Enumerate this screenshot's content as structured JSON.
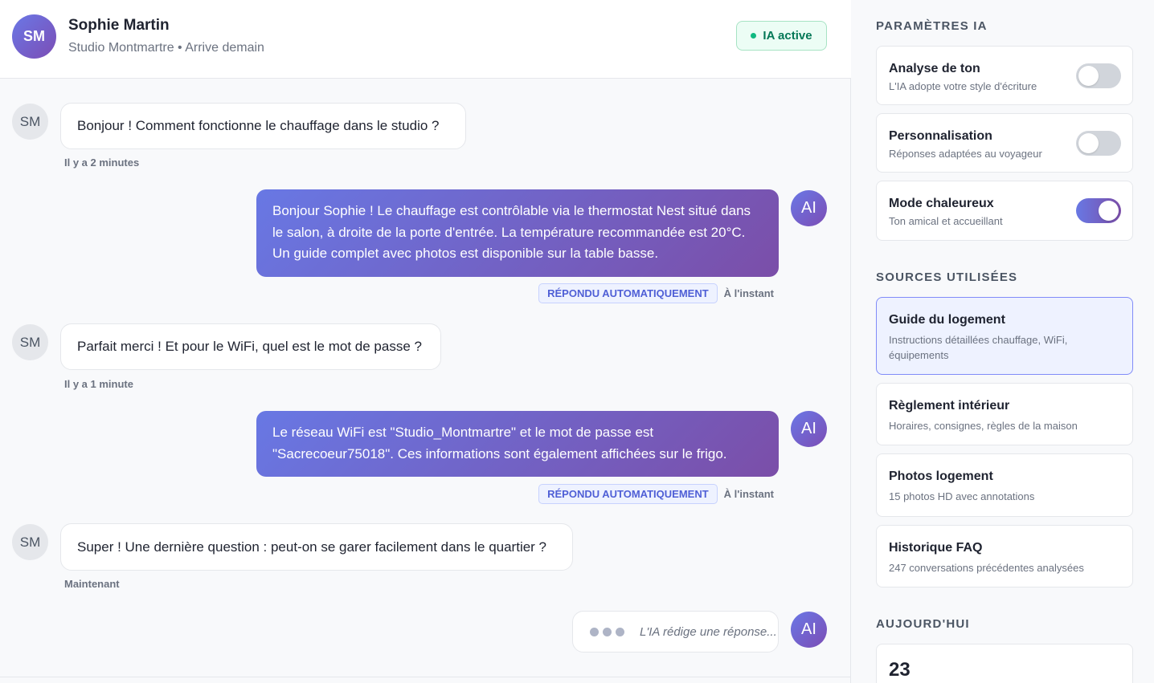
{
  "header": {
    "avatar_initials": "SM",
    "guest_name": "Sophie Martin",
    "subtitle": "Studio Montmartre • Arrive demain",
    "ia_status": "IA active"
  },
  "messages": [
    {
      "from": "guest",
      "avatar": "SM",
      "text": "Bonjour ! Comment fonctionne le chauffage dans le studio ?",
      "time": "Il y a 2 minutes"
    },
    {
      "from": "ai",
      "avatar": "AI",
      "text": "Bonjour Sophie ! Le chauffage est contrôlable via le thermostat Nest situé dans le salon, à droite de la porte d'entrée. La température recommandée est 20°C. Un guide complet avec photos est disponible sur la table basse.",
      "badge": "RÉPONDU AUTOMATIQUEMENT",
      "time": "À l'instant"
    },
    {
      "from": "guest",
      "avatar": "SM",
      "text": "Parfait merci ! Et pour le WiFi, quel est le mot de passe ?",
      "time": "Il y a 1 minute"
    },
    {
      "from": "ai",
      "avatar": "AI",
      "text": "Le réseau WiFi est \"Studio_Montmartre\" et le mot de passe est \"Sacrecoeur75018\". Ces informations sont également affichées sur le frigo.",
      "badge": "RÉPONDU AUTOMATIQUEMENT",
      "time": "À l'instant"
    },
    {
      "from": "guest",
      "avatar": "SM",
      "text": "Super ! Une dernière question : peut-on se garer facilement dans le quartier ?",
      "time": "Maintenant"
    }
  ],
  "typing": {
    "avatar": "AI",
    "text": "L'IA rédige une réponse..."
  },
  "sidebar": {
    "ia_settings_title": "PARAMÈTRES IA",
    "settings": [
      {
        "title": "Analyse de ton",
        "subtitle": "L'IA adopte votre style d'écriture",
        "enabled": false
      },
      {
        "title": "Personnalisation",
        "subtitle": "Réponses adaptées au voyageur",
        "enabled": false
      },
      {
        "title": "Mode chaleureux",
        "subtitle": "Ton amical et accueillant",
        "enabled": true
      }
    ],
    "sources_title": "SOURCES UTILISÉES",
    "sources": [
      {
        "title": "Guide du logement",
        "subtitle": "Instructions détaillées chauffage, WiFi, équipements",
        "active": true
      },
      {
        "title": "Règlement intérieur",
        "subtitle": "Horaires, consignes, règles de la maison",
        "active": false
      },
      {
        "title": "Photos logement",
        "subtitle": "15 photos HD avec annotations",
        "active": false
      },
      {
        "title": "Historique FAQ",
        "subtitle": "247 conversations précédentes analysées",
        "active": false
      }
    ],
    "today_title": "AUJOURD'HUI",
    "today_value": "23"
  },
  "colors": {
    "accent_start": "#6878e4",
    "accent_end": "#7b4ea8",
    "status_green": "#10b981"
  }
}
